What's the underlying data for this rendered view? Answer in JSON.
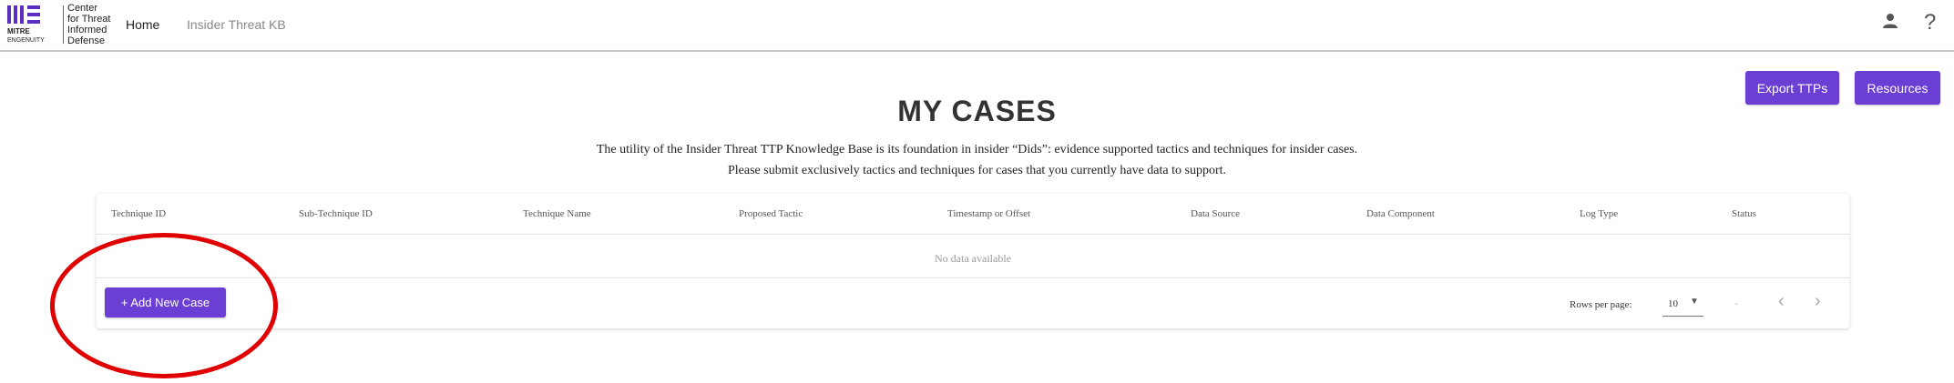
{
  "header": {
    "logo_word1": "MITRE",
    "logo_word2": "ENGENUITY",
    "logo_lines": [
      "Center",
      "for Threat",
      "Informed",
      "Defense"
    ],
    "nav": [
      {
        "label": "Home"
      },
      {
        "label": "Insider Threat KB"
      }
    ],
    "help_label": "?"
  },
  "actions": {
    "export_label": "Export TTPs",
    "resources_label": "Resources"
  },
  "page": {
    "title": "MY CASES",
    "description_line1": "The utility of the Insider Threat TTP Knowledge Base is its foundation in insider “Dids”: evidence supported tactics and techniques for insider cases.",
    "description_line2": "Please submit exclusively tactics and techniques for cases that you currently have data to support."
  },
  "table": {
    "columns": [
      "Technique ID",
      "Sub-Technique ID",
      "Technique Name",
      "Proposed Tactic",
      "Timestamp or Offset",
      "Data Source",
      "Data Component",
      "Log Type",
      "Status"
    ],
    "empty_text": "No data available",
    "add_button_label": "+ Add New Case",
    "pagination": {
      "rows_per_page_label": "Rows per page:",
      "rows_per_page_value": "10",
      "range_text": "-",
      "prev_label": "‹",
      "next_label": "›"
    }
  },
  "colors": {
    "accent": "#6b3fd4",
    "annotation": "#e00000"
  }
}
